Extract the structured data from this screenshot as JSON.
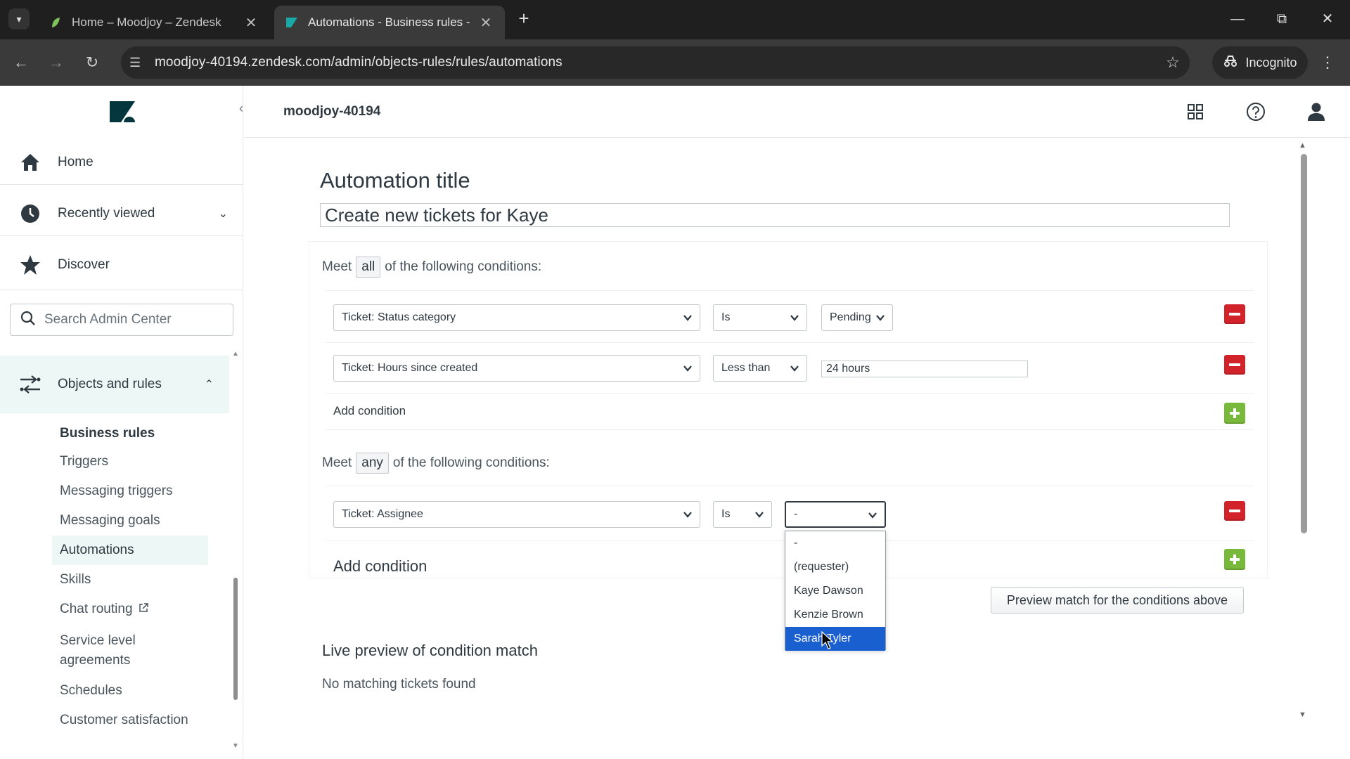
{
  "browser": {
    "tabs": [
      {
        "title": "Home – Moodjoy – Zendesk",
        "active": false
      },
      {
        "title": "Automations - Business rules -",
        "active": true
      }
    ],
    "url": "moodjoy-40194.zendesk.com/admin/objects-rules/rules/automations",
    "profile_label": "Incognito"
  },
  "sidebar": {
    "nav": [
      {
        "label": "Home",
        "icon": "home-icon"
      },
      {
        "label": "Recently viewed",
        "icon": "clock-icon"
      },
      {
        "label": "Discover",
        "icon": "star-icon"
      }
    ],
    "search_placeholder": "Search Admin Center",
    "section_label": "Objects and rules",
    "subsection_heading": "Business rules",
    "sub_items": [
      {
        "label": "Triggers",
        "active": false
      },
      {
        "label": "Messaging triggers",
        "active": false
      },
      {
        "label": "Messaging goals",
        "active": false
      },
      {
        "label": "Automations",
        "active": true
      },
      {
        "label": "Skills",
        "active": false
      },
      {
        "label": "Chat routing",
        "active": false,
        "external": true
      },
      {
        "label": "Service level agreements",
        "active": false
      },
      {
        "label": "Schedules",
        "active": false
      },
      {
        "label": "Customer satisfaction",
        "active": false
      }
    ]
  },
  "header": {
    "account": "moodjoy-40194"
  },
  "automation": {
    "title_label": "Automation title",
    "title_value": "Create new tickets for Kaye",
    "all_group": {
      "meet_prefix": "Meet",
      "qualifier": "all",
      "meet_suffix": "of the following conditions:",
      "conditions": [
        {
          "field": "Ticket: Status category",
          "operator": "Is",
          "value": "Pending"
        },
        {
          "field": "Ticket: Hours since created",
          "operator": "Less than",
          "value": "24 hours"
        }
      ],
      "add_label": "Add condition"
    },
    "any_group": {
      "meet_prefix": "Meet",
      "qualifier": "any",
      "meet_suffix": "of the following conditions:",
      "conditions": [
        {
          "field": "Ticket: Assignee",
          "operator": "Is",
          "value": "-"
        }
      ],
      "add_label": "Add condition"
    },
    "assignee_dropdown": {
      "options": [
        "-",
        "(requester)",
        "Kaye Dawson",
        "Kenzie Brown",
        "Sarah Tyler"
      ],
      "highlighted": "Sarah Tyler"
    },
    "preview_button": "Preview match for the conditions above",
    "live_preview_label": "Live preview of condition match",
    "no_match_text": "No matching tickets found"
  },
  "colors": {
    "remove": "#d2232a",
    "add": "#78b93b",
    "active_nav_bg": "#edf7f5",
    "dropdown_highlight": "#1a5fd0"
  }
}
